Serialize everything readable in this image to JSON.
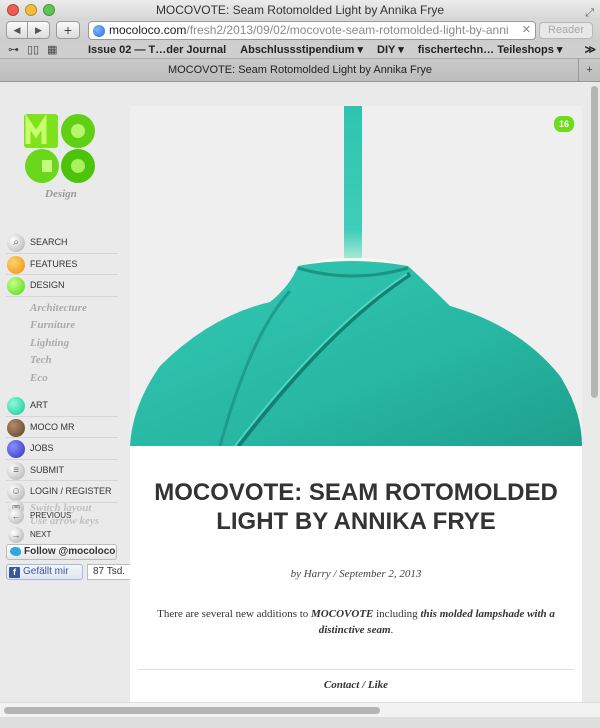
{
  "window": {
    "title": "MOCOVOTE: Seam Rotomolded Light by Annika Frye"
  },
  "toolbar": {
    "back_icon": "back-arrow-icon",
    "forward_icon": "forward-arrow-icon",
    "add_label": "+",
    "url_domain": "mocoloco.com",
    "url_path": "/fresh2/2013/09/02/mocovote-seam-rotomolded-light-by-anni",
    "reader_label": "Reader"
  },
  "bookmarks": {
    "items": [
      "Issue 02 — T…der Journal",
      "Abschlussstipendium ▾",
      "DIY ▾",
      "fischertechn… Teileshops ▾"
    ],
    "more": "≫"
  },
  "tab": {
    "title": "MOCOVOTE: Seam Rotomolded Light by Annika Frye"
  },
  "site": {
    "logo_sub": "Design",
    "nav": [
      {
        "label": "Search",
        "color": "#aaaaaa"
      },
      {
        "label": "Features",
        "color": "#f08c10"
      },
      {
        "label": "Design",
        "color": "#4dd60f"
      }
    ],
    "design_sub": [
      "Architecture",
      "Furniture",
      "Lighting",
      "Tech",
      "Eco"
    ],
    "nav2": [
      {
        "label": "Art",
        "color": "#14c59c"
      },
      {
        "label": "Moco MR",
        "color": "#5e4028"
      },
      {
        "label": "Jobs",
        "color": "#2d32b8"
      },
      {
        "label": "Submit",
        "color": "#aaaaaa"
      },
      {
        "label": "Login / Register",
        "color": "#aaaaaa"
      }
    ],
    "switch_layout": "Switch layout",
    "use_arrow_keys": "Use arrow keys",
    "previous": "Previous",
    "next": "Next",
    "follow": "Follow @mocoloco",
    "like": "Gefällt mir",
    "like_count": "87 Tsd."
  },
  "article": {
    "badge": "16",
    "title": "MOCOVOTE: Seam Rotomolded Light by Annika Frye",
    "byline": "by Harry / September 2, 2013",
    "intro_before": "There are several new additions to ",
    "intro_em1": "MOCOVOTE",
    "intro_mid": " including ",
    "intro_em2": "this molded lampshade with a distinctive seam",
    "intro_after": ".",
    "contact": "Contact / Like",
    "lamp_color": "#2ec4b0"
  }
}
